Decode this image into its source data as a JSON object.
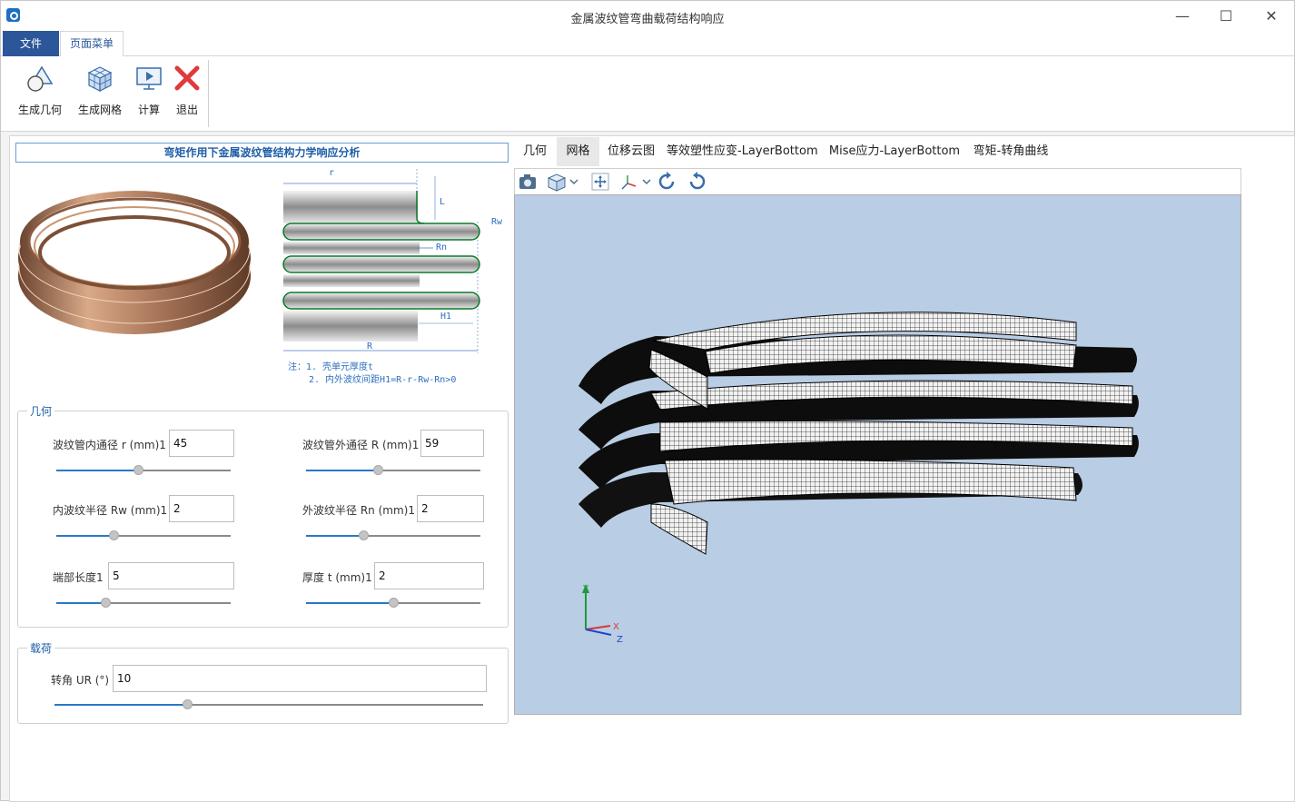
{
  "window": {
    "title": "金属波纹管弯曲载荷结构响应",
    "controls": {
      "minimize": "—",
      "maximize": "☐",
      "close": "✕"
    }
  },
  "ribbon": {
    "tabs": [
      "文件",
      "页面菜单"
    ],
    "buttons": [
      {
        "label": "生成几何",
        "icon": "geometry-icon"
      },
      {
        "label": "生成网格",
        "icon": "mesh-cube-icon"
      },
      {
        "label": "计算",
        "icon": "monitor-play-icon"
      },
      {
        "label": "退出",
        "icon": "red-x-icon"
      }
    ]
  },
  "left_panel": {
    "title": "弯矩作用下金属波纹管结构力学响应分析",
    "diagram": {
      "labels": {
        "r": "r",
        "L": "L",
        "Rw": "Rw",
        "Rn": "Rn",
        "H1": "H1",
        "R": "R"
      },
      "notes": [
        "注：1. 壳单元厚度t",
        "2. 内外波纹间距H1=R-r-Rw-Rn>0"
      ]
    },
    "geometry": {
      "legend": "几何",
      "fields": [
        {
          "label": "波纹管内通径 r (mm)1",
          "value": "45",
          "slider": 0.47
        },
        {
          "label": "波纹管外通径 R (mm)1",
          "value": "59",
          "slider": 0.41
        },
        {
          "label": "内波纹半径 Rw (mm)1",
          "value": "2",
          "slider": 0.33
        },
        {
          "label": "外波纹半径 Rn (mm)1",
          "value": "2",
          "slider": 0.33
        },
        {
          "label": "端部长度1",
          "value": "5",
          "slider": 0.28
        },
        {
          "label": "厚度 t (mm)1",
          "value": "2",
          "slider": 0.5
        }
      ]
    },
    "load": {
      "legend": "载荷",
      "field": {
        "label": "转角 UR (°)",
        "value": "10",
        "slider": 0.31
      }
    }
  },
  "viewer": {
    "tabs": [
      "几何",
      "网格",
      "位移云图",
      "等效塑性应变-LayerBottom",
      "Mise应力-LayerBottom",
      "弯矩-转角曲线"
    ],
    "active_tab": "网格",
    "toolbar": [
      "camera-icon",
      "view-cube-icon",
      "fit-all-icon",
      "axis-triad-icon",
      "rotate-ccw-icon",
      "rotate-cw-icon"
    ],
    "background": "#b9cde4",
    "axes": {
      "x": "X",
      "y": "Y",
      "z": "Z"
    }
  },
  "colors": {
    "accent": "#2b579a",
    "title": "#1f5fa8",
    "slider": "#2a78c8"
  }
}
